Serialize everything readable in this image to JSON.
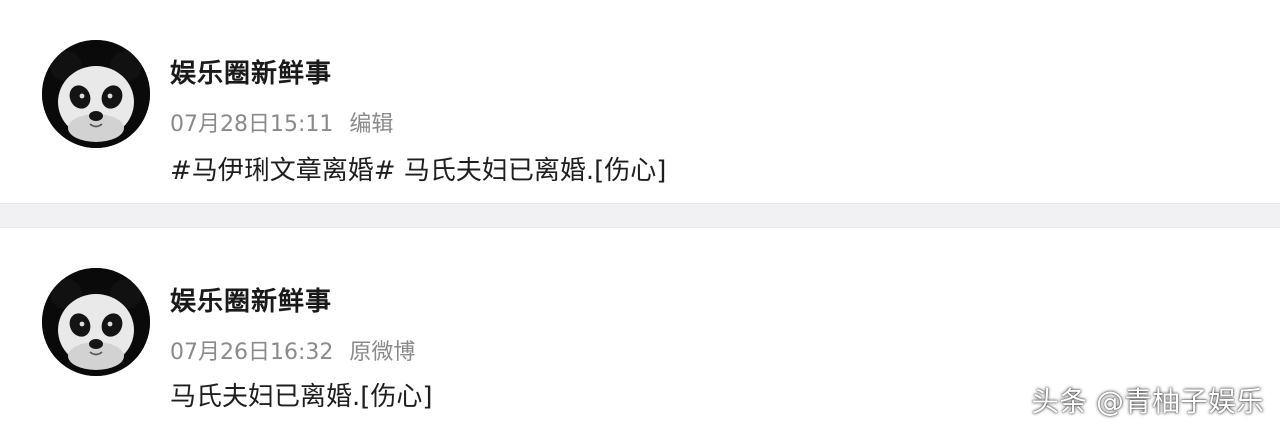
{
  "posts": [
    {
      "author": "娱乐圈新鲜事",
      "time": "07月28日15:11",
      "action": "编辑",
      "content": "#马伊琍文章离婚# 马氏夫妇已离婚.[伤心]"
    },
    {
      "author": "娱乐圈新鲜事",
      "time": "07月26日16:32",
      "action": "原微博",
      "content": "马氏夫妇已离婚.[伤心]"
    }
  ],
  "watermark": "头条 @青柚子娱乐",
  "colors": {
    "name": "#1a1a1a",
    "meta": "#8a8a8a",
    "content": "#1e1e1e",
    "divider": "#f1f1f3"
  }
}
